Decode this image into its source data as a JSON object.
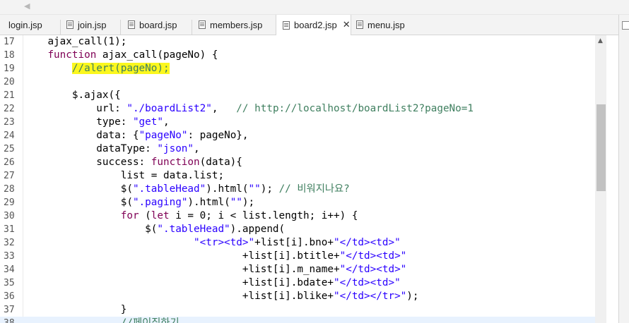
{
  "tabs": [
    {
      "label": "login.jsp"
    },
    {
      "label": "join.jsp"
    },
    {
      "label": "board.jsp"
    },
    {
      "label": "members.jsp"
    },
    {
      "label": "board2.jsp",
      "close": "✕"
    },
    {
      "label": "menu.jsp"
    }
  ],
  "editor": {
    "lines": [
      {
        "num": "17"
      },
      {
        "num": "18"
      },
      {
        "num": "19"
      },
      {
        "num": "20"
      },
      {
        "num": "21"
      },
      {
        "num": "22"
      },
      {
        "num": "23"
      },
      {
        "num": "24"
      },
      {
        "num": "25"
      },
      {
        "num": "26"
      },
      {
        "num": "27"
      },
      {
        "num": "28"
      },
      {
        "num": "29"
      },
      {
        "num": "30"
      },
      {
        "num": "31"
      },
      {
        "num": "32"
      },
      {
        "num": "33"
      },
      {
        "num": "34"
      },
      {
        "num": "35"
      },
      {
        "num": "36"
      },
      {
        "num": "37"
      },
      {
        "num": "38"
      }
    ],
    "code": {
      "l17": "ajax_call(1);",
      "l18_kw": "function",
      "l18_rest": " ajax_call(pageNo) {",
      "l19": "//alert(pageNo);",
      "l21": "$.ajax({",
      "l22_a": "url: ",
      "l22_str": "\"./boardList2\"",
      "l22_b": ",   ",
      "l22_cmt": "// http://localhost/boardList2?pageNo=1",
      "l23_a": "type: ",
      "l23_str": "\"get\"",
      "l23_b": ",",
      "l24_a": "data: {",
      "l24_str": "\"pageNo\"",
      "l24_b": ": pageNo},",
      "l25_a": "dataType: ",
      "l25_str": "\"json\"",
      "l25_b": ",",
      "l26_a": "success: ",
      "l26_kw": "function",
      "l26_b": "(data){",
      "l27": "list = data.list;",
      "l28_a": "$(",
      "l28_str1": "\".tableHead\"",
      "l28_b": ").html(",
      "l28_str2": "\"\"",
      "l28_c": "); ",
      "l28_cmt": "// 비워지나요?",
      "l29_a": "$(",
      "l29_str1": "\".paging\"",
      "l29_b": ").html(",
      "l29_str2": "\"\"",
      "l29_c": ");",
      "l30_kw1": "for",
      "l30_a": " (",
      "l30_kw2": "let",
      "l30_b": " i = 0; i < list.length; i++) {",
      "l31_a": "$(",
      "l31_str": "\".tableHead\"",
      "l31_b": ").append(",
      "l32_str1": "\"<tr><td>\"",
      "l32_a": "+list[i].bno+",
      "l32_str2": "\"</td><td>\"",
      "l33_a": "+list[i].btitle+",
      "l33_str": "\"</td><td>\"",
      "l34_a": "+list[i].m_name+",
      "l34_str": "\"</td><td>\"",
      "l35_a": "+list[i].bdate+",
      "l35_str": "\"</td><td>\"",
      "l36_a": "+list[i].blike+",
      "l36_str": "\"</td></tr>\"",
      "l36_b": ");",
      "l37": "}",
      "l38": "//페이징하기"
    }
  },
  "colors": {
    "keyword": "#7f0055",
    "string": "#2a00ff",
    "comment": "#3f7f5f",
    "highlight": "#fbf71e",
    "current_line": "#e8f2fe"
  }
}
